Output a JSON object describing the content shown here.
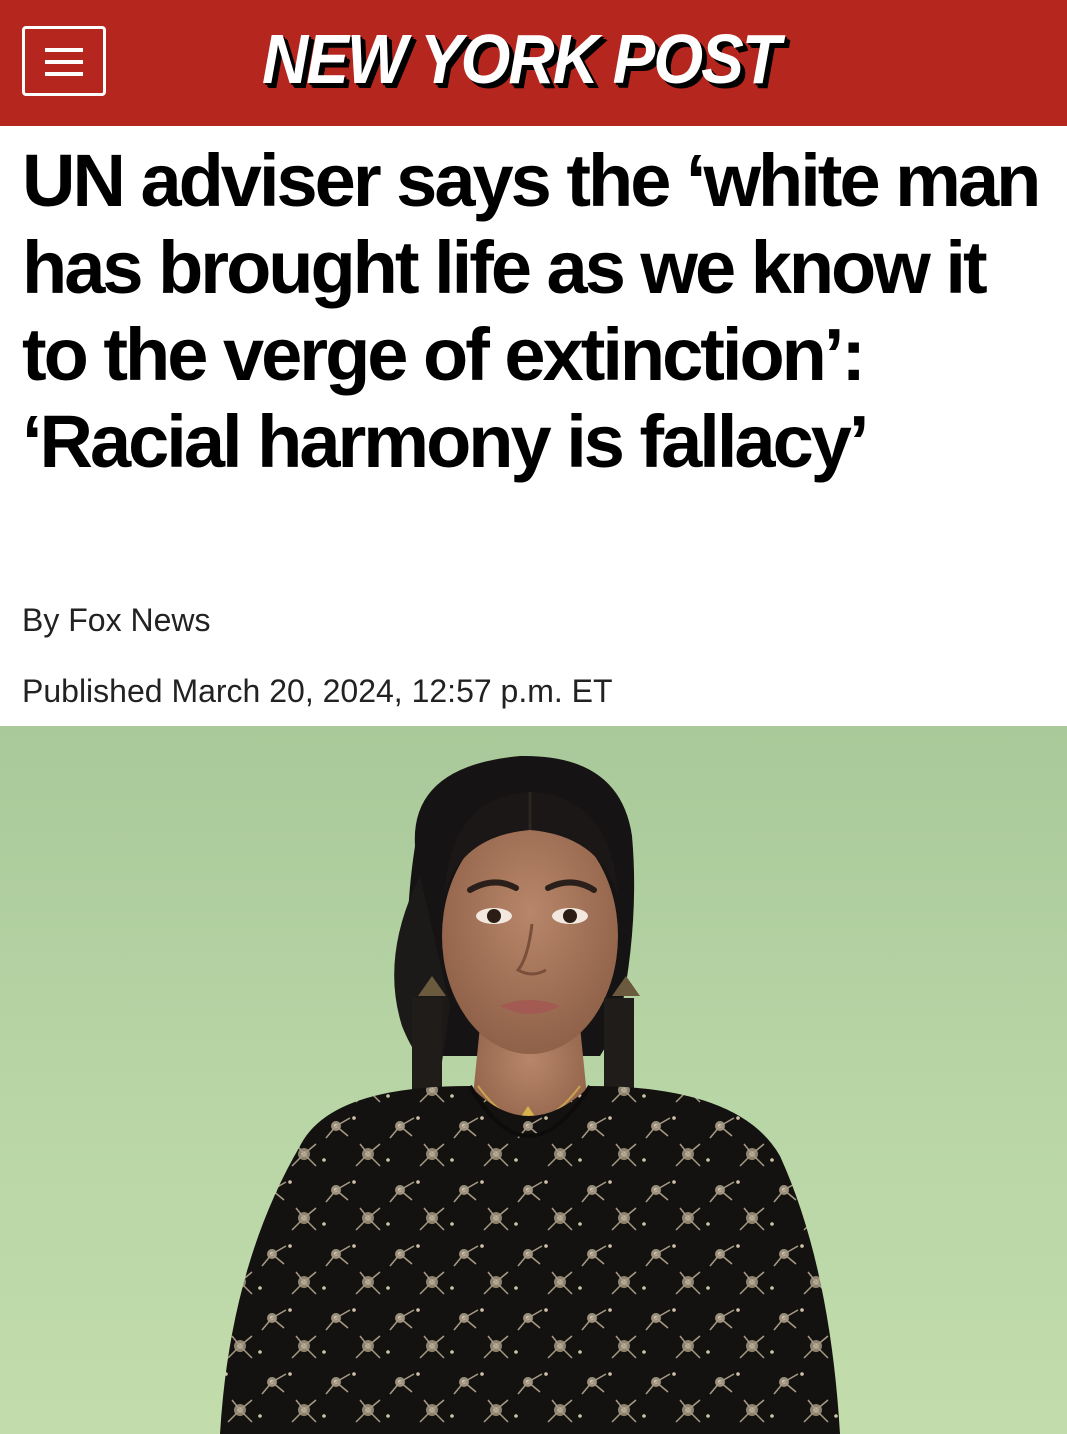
{
  "header": {
    "logo_text": "NEW YORK POST",
    "menu_icon": "hamburger-menu-icon",
    "brand_color": "#b5261e"
  },
  "article": {
    "headline": "UN adviser says the ‘white man has brought life as we know it to the verge of extinction’: ‘Racial harmony is fallacy’",
    "byline": "By Fox News",
    "published": "Published March 20, 2024, 12:57 p.m. ET"
  },
  "photo": {
    "subject": "portrait-photo",
    "background_color": "#b4d3a3"
  }
}
